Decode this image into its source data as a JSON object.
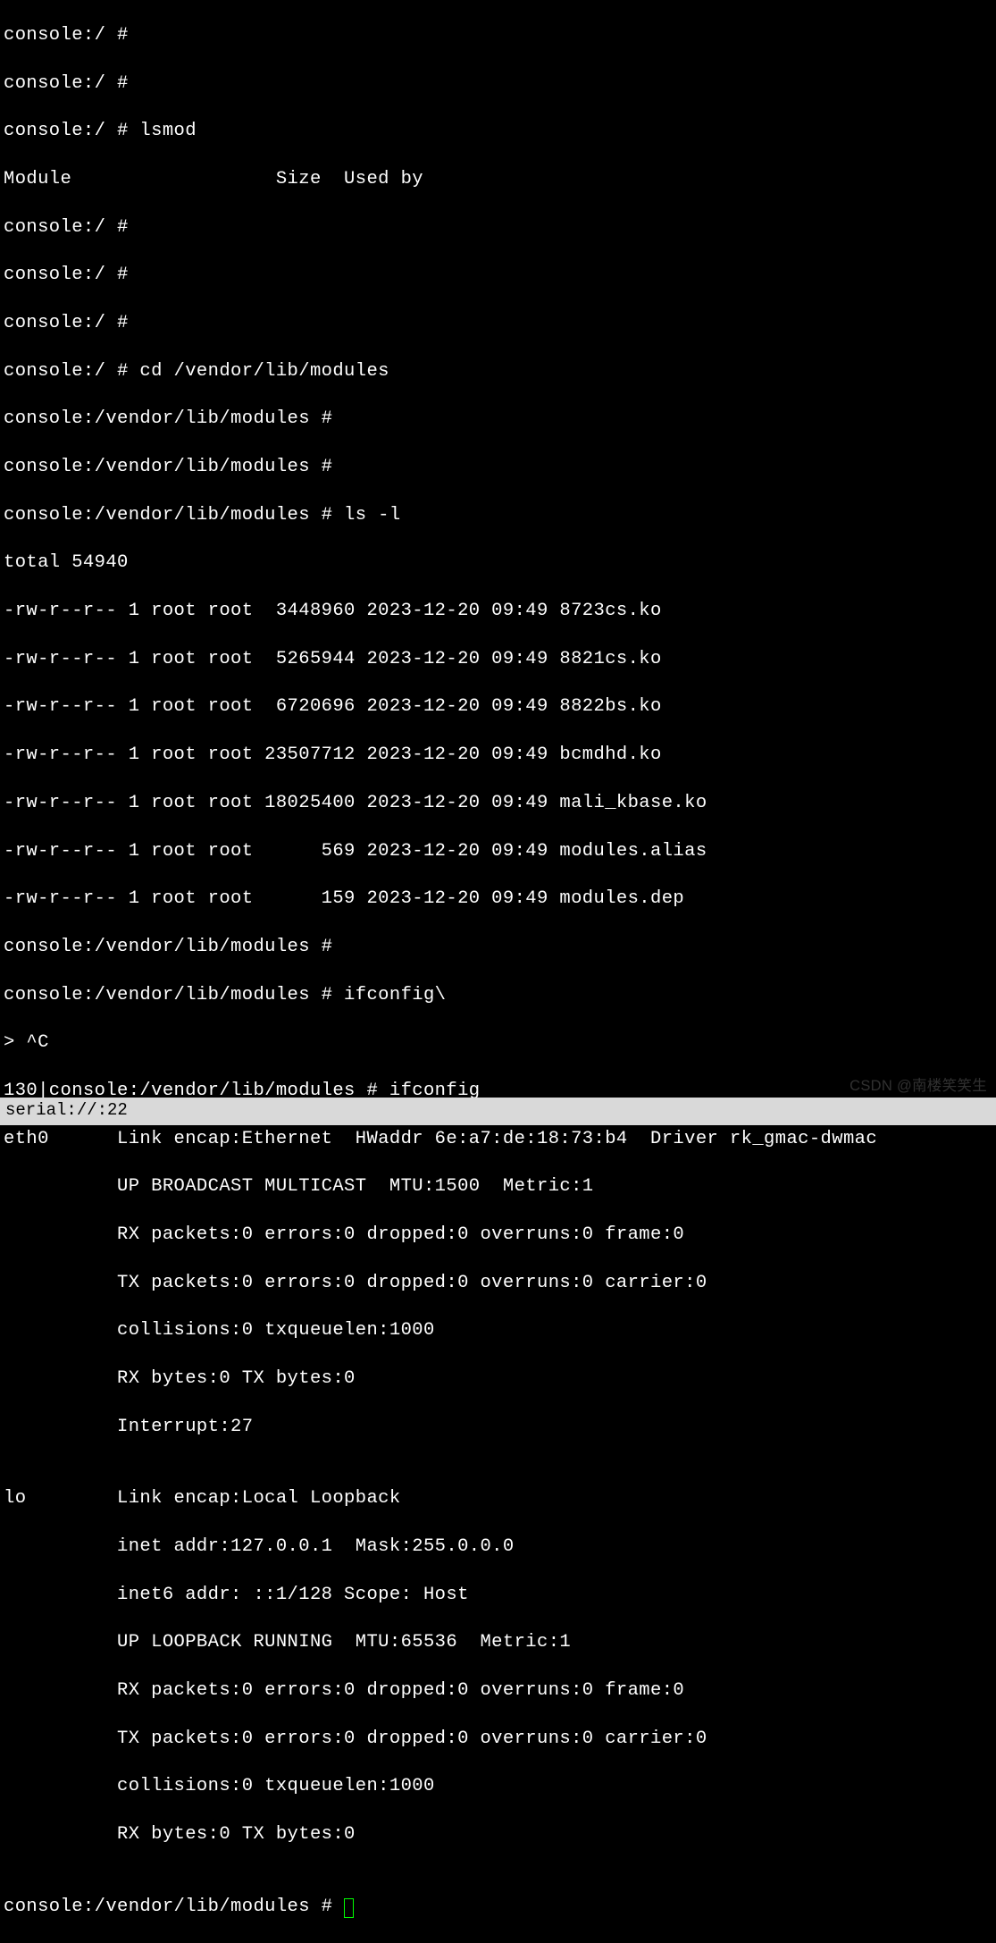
{
  "lines": [
    "console:/ #",
    "console:/ #",
    "console:/ # lsmod",
    "Module                  Size  Used by",
    "console:/ #",
    "console:/ #",
    "console:/ #",
    "console:/ # cd /vendor/lib/modules",
    "console:/vendor/lib/modules #",
    "console:/vendor/lib/modules #",
    "console:/vendor/lib/modules # ls -l",
    "total 54940",
    "-rw-r--r-- 1 root root  3448960 2023-12-20 09:49 8723cs.ko",
    "-rw-r--r-- 1 root root  5265944 2023-12-20 09:49 8821cs.ko",
    "-rw-r--r-- 1 root root  6720696 2023-12-20 09:49 8822bs.ko",
    "-rw-r--r-- 1 root root 23507712 2023-12-20 09:49 bcmdhd.ko",
    "-rw-r--r-- 1 root root 18025400 2023-12-20 09:49 mali_kbase.ko",
    "-rw-r--r-- 1 root root      569 2023-12-20 09:49 modules.alias",
    "-rw-r--r-- 1 root root      159 2023-12-20 09:49 modules.dep",
    "console:/vendor/lib/modules #",
    "console:/vendor/lib/modules # ifconfig\\",
    "> ^C",
    "130|console:/vendor/lib/modules # ifconfig",
    "eth0      Link encap:Ethernet  HWaddr 6e:a7:de:18:73:b4  Driver rk_gmac-dwmac",
    "          UP BROADCAST MULTICAST  MTU:1500  Metric:1",
    "          RX packets:0 errors:0 dropped:0 overruns:0 frame:0",
    "          TX packets:0 errors:0 dropped:0 overruns:0 carrier:0",
    "          collisions:0 txqueuelen:1000",
    "          RX bytes:0 TX bytes:0",
    "          Interrupt:27",
    "",
    "lo        Link encap:Local Loopback",
    "          inet addr:127.0.0.1  Mask:255.0.0.0",
    "          inet6 addr: ::1/128 Scope: Host",
    "          UP LOOPBACK RUNNING  MTU:65536  Metric:1",
    "          RX packets:0 errors:0 dropped:0 overruns:0 frame:0",
    "          TX packets:0 errors:0 dropped:0 overruns:0 carrier:0",
    "          collisions:0 txqueuelen:1000",
    "          RX bytes:0 TX bytes:0",
    ""
  ],
  "current_prompt": "console:/vendor/lib/modules # ",
  "status_bar": "serial://:22",
  "watermark": "CSDN @南楼笑笑生"
}
